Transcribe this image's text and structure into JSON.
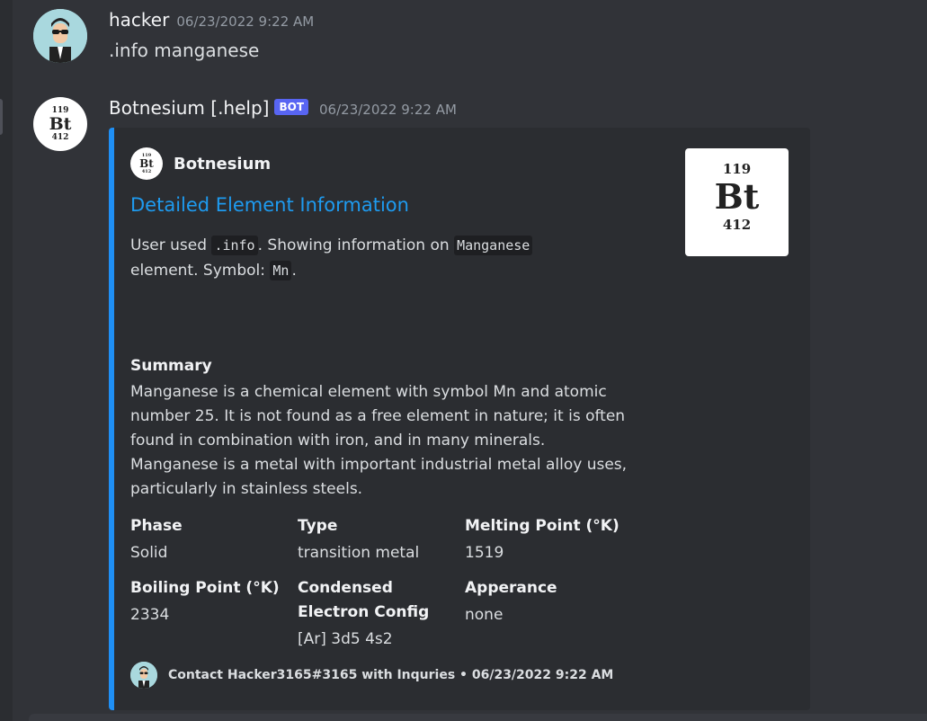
{
  "messages": {
    "user": {
      "author": "hacker",
      "timestamp": "06/23/2022 9:22 AM",
      "text": ".info manganese"
    },
    "bot": {
      "author": "Botnesium [.help]",
      "tag": "BOT",
      "timestamp": "06/23/2022 9:22 AM"
    }
  },
  "embed": {
    "accent_color": "#1f8ff5",
    "author_name": "Botnesium",
    "title": "Detailed Element Information",
    "desc_prefix": "User used ",
    "desc_cmd": ".info",
    "desc_mid": ". Showing information on ",
    "desc_element": "Manganese",
    "desc_mid2": " element. Symbol: ",
    "desc_symbol": "Mn",
    "desc_suffix": ".",
    "thumbnail": {
      "top_number": "119",
      "symbol": "Bt",
      "bottom_number": "412"
    },
    "summary": {
      "name": "Summary",
      "value": "Manganese is a chemical element with symbol Mn and atomic number 25. It is not found as a free element in nature; it is often found in combination with iron, and in many minerals. Manganese is a metal with important industrial metal alloy uses, particularly in stainless steels."
    },
    "fields": [
      {
        "name": "Phase",
        "value": "Solid"
      },
      {
        "name": "Type",
        "value": "transition metal"
      },
      {
        "name": "Melting Point (°K)",
        "value": "1519"
      },
      {
        "name": "Boiling Point (°K)",
        "value": "2334"
      },
      {
        "name": "Condensed Electron Config",
        "value": "[Ar] 3d5 4s2"
      },
      {
        "name": "Apperance",
        "value": "none"
      }
    ],
    "footer": "Contact Hacker3165#3165 with Inquries • 06/23/2022 9:22 AM"
  }
}
